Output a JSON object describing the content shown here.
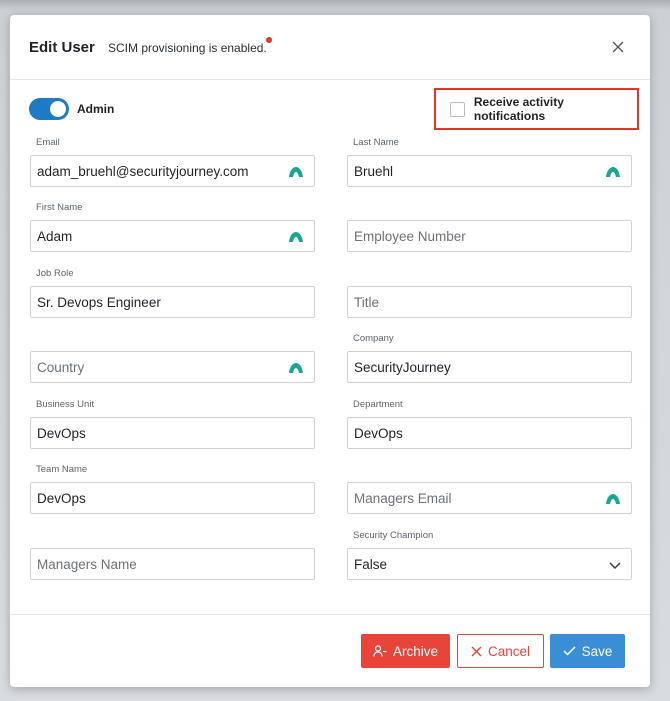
{
  "header": {
    "title": "Edit User",
    "subtitle": "SCIM provisioning is enabled."
  },
  "admin": {
    "label": "Admin",
    "enabled": true
  },
  "notifications": {
    "label": "Receive activity notifications",
    "checked": false
  },
  "fields": {
    "email": {
      "label": "Email",
      "value": "adam_bruehl@securityjourney.com"
    },
    "last_name": {
      "label": "Last Name",
      "value": "Bruehl"
    },
    "first_name": {
      "label": "First Name",
      "value": "Adam"
    },
    "employee_number": {
      "placeholder": "Employee Number"
    },
    "job_role": {
      "label": "Job Role",
      "value": "Sr. Devops Engineer"
    },
    "title": {
      "placeholder": "Title"
    },
    "country": {
      "placeholder": "Country"
    },
    "company": {
      "label": "Company",
      "value": "SecurityJourney"
    },
    "business_unit": {
      "label": "Business Unit",
      "value": "DevOps"
    },
    "department": {
      "label": "Department",
      "value": "DevOps"
    },
    "team_name": {
      "label": "Team Name",
      "value": "DevOps"
    },
    "managers_email": {
      "placeholder": "Managers Email"
    },
    "managers_name": {
      "placeholder": "Managers Name"
    },
    "security_champion": {
      "label": "Security Champion",
      "value": "False"
    }
  },
  "footer": {
    "archive_label": "Archive",
    "cancel_label": "Cancel",
    "save_label": "Save"
  },
  "colors": {
    "primary": "#1f7ac6",
    "danger": "#e8443a",
    "save": "#3a8fd4",
    "autofill_icon": "#1aa595"
  }
}
